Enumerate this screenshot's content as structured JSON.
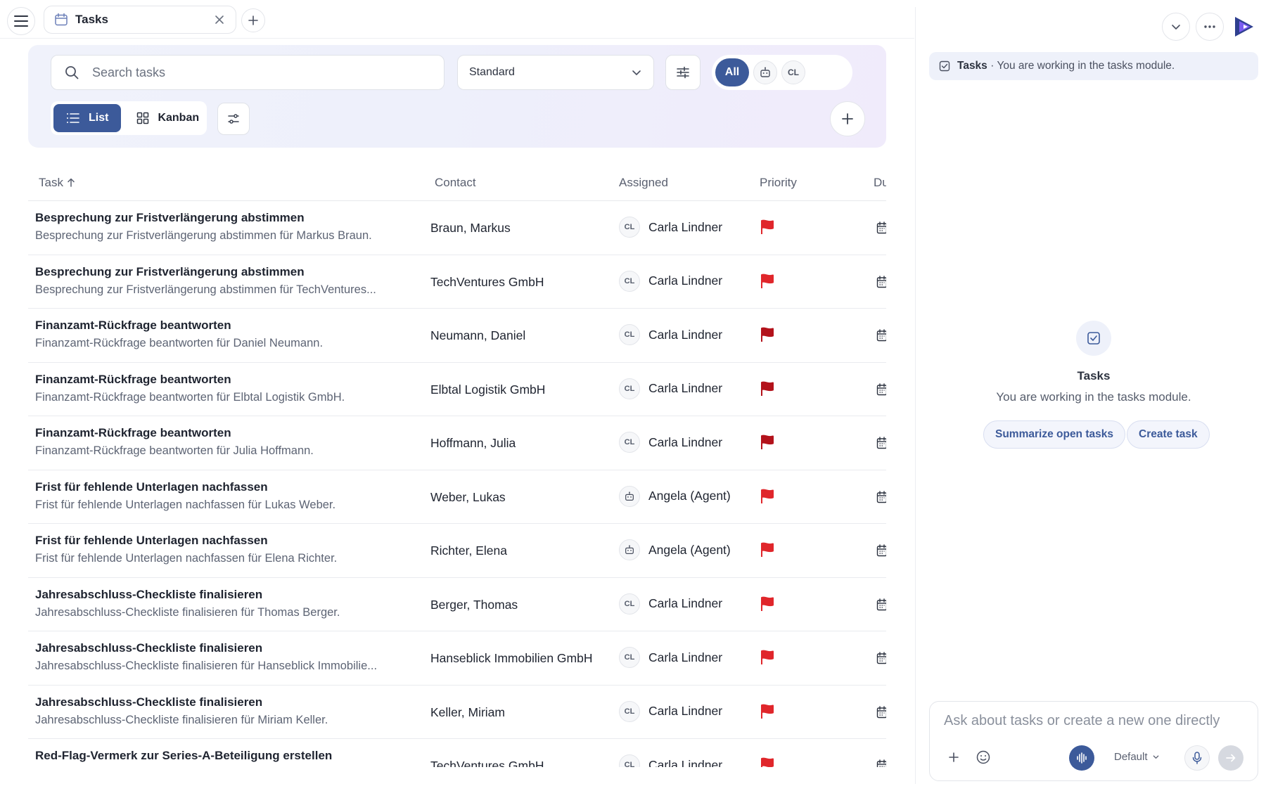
{
  "tab": {
    "label": "Tasks"
  },
  "search": {
    "placeholder": "Search tasks"
  },
  "view_select": {
    "value": "Standard"
  },
  "owner_filter": {
    "all_label": "All",
    "me_initials": "CL"
  },
  "view_toggle": {
    "list_label": "List",
    "kanban_label": "Kanban"
  },
  "table": {
    "columns": {
      "task": "Task",
      "contact": "Contact",
      "assigned": "Assigned",
      "priority": "Priority",
      "due": "Du"
    },
    "rows": [
      {
        "title": "Besprechung zur Fristverlängerung abstimmen",
        "subtitle": "Besprechung zur Fristverlängerung abstimmen für Markus Braun.",
        "contact": "Braun, Markus",
        "assignee_initials": "CL",
        "assignee": "Carla Lindner",
        "assignee_type": "user",
        "priority_color": "#e0262b"
      },
      {
        "title": "Besprechung zur Fristverlängerung abstimmen",
        "subtitle": "Besprechung zur Fristverlängerung abstimmen für TechVentures...",
        "contact": "TechVentures GmbH",
        "assignee_initials": "CL",
        "assignee": "Carla Lindner",
        "assignee_type": "user",
        "priority_color": "#e0262b"
      },
      {
        "title": "Finanzamt-Rückfrage beantworten",
        "subtitle": "Finanzamt-Rückfrage beantworten für Daniel Neumann.",
        "contact": "Neumann, Daniel",
        "assignee_initials": "CL",
        "assignee": "Carla Lindner",
        "assignee_type": "user",
        "priority_color": "#b3121b"
      },
      {
        "title": "Finanzamt-Rückfrage beantworten",
        "subtitle": "Finanzamt-Rückfrage beantworten für Elbtal Logistik GmbH.",
        "contact": "Elbtal Logistik GmbH",
        "assignee_initials": "CL",
        "assignee": "Carla Lindner",
        "assignee_type": "user",
        "priority_color": "#b3121b"
      },
      {
        "title": "Finanzamt-Rückfrage beantworten",
        "subtitle": "Finanzamt-Rückfrage beantworten für Julia Hoffmann.",
        "contact": "Hoffmann, Julia",
        "assignee_initials": "CL",
        "assignee": "Carla Lindner",
        "assignee_type": "user",
        "priority_color": "#b3121b"
      },
      {
        "title": "Frist für fehlende Unterlagen nachfassen",
        "subtitle": "Frist für fehlende Unterlagen nachfassen für Lukas Weber.",
        "contact": "Weber, Lukas",
        "assignee_initials": "",
        "assignee": "Angela (Agent)",
        "assignee_type": "agent",
        "priority_color": "#e0262b"
      },
      {
        "title": "Frist für fehlende Unterlagen nachfassen",
        "subtitle": "Frist für fehlende Unterlagen nachfassen für Elena Richter.",
        "contact": "Richter, Elena",
        "assignee_initials": "",
        "assignee": "Angela (Agent)",
        "assignee_type": "agent",
        "priority_color": "#e0262b"
      },
      {
        "title": "Jahresabschluss-Checkliste finalisieren",
        "subtitle": "Jahresabschluss-Checkliste finalisieren für Thomas Berger.",
        "contact": "Berger, Thomas",
        "assignee_initials": "CL",
        "assignee": "Carla Lindner",
        "assignee_type": "user",
        "priority_color": "#e0262b"
      },
      {
        "title": "Jahresabschluss-Checkliste finalisieren",
        "subtitle": "Jahresabschluss-Checkliste finalisieren für Hanseblick Immobilie...",
        "contact": "Hanseblick Immobilien GmbH",
        "assignee_initials": "CL",
        "assignee": "Carla Lindner",
        "assignee_type": "user",
        "priority_color": "#e0262b"
      },
      {
        "title": "Jahresabschluss-Checkliste finalisieren",
        "subtitle": "Jahresabschluss-Checkliste finalisieren für Miriam Keller.",
        "contact": "Keller, Miriam",
        "assignee_initials": "CL",
        "assignee": "Carla Lindner",
        "assignee_type": "user",
        "priority_color": "#e0262b"
      },
      {
        "title": "Red-Flag-Vermerk zur Series-A-Beteiligung erstellen",
        "subtitle": "",
        "contact": "TechVentures GmbH",
        "assignee_initials": "CL",
        "assignee": "Carla Lindner",
        "assignee_type": "user",
        "priority_color": "#e0262b"
      }
    ]
  },
  "assistant": {
    "context_title": "Tasks",
    "context_text": "· You are working in the tasks module.",
    "empty_title": "Tasks",
    "empty_subtitle": "You are working in the tasks module.",
    "suggestions": [
      "Summarize open tasks",
      "Create task"
    ],
    "composer_placeholder": "Ask about tasks or create a new one directly",
    "model_label": "Default"
  },
  "colors": {
    "accent": "#3c5a9a",
    "priority_high": "#e0262b",
    "priority_urgent": "#b3121b"
  }
}
